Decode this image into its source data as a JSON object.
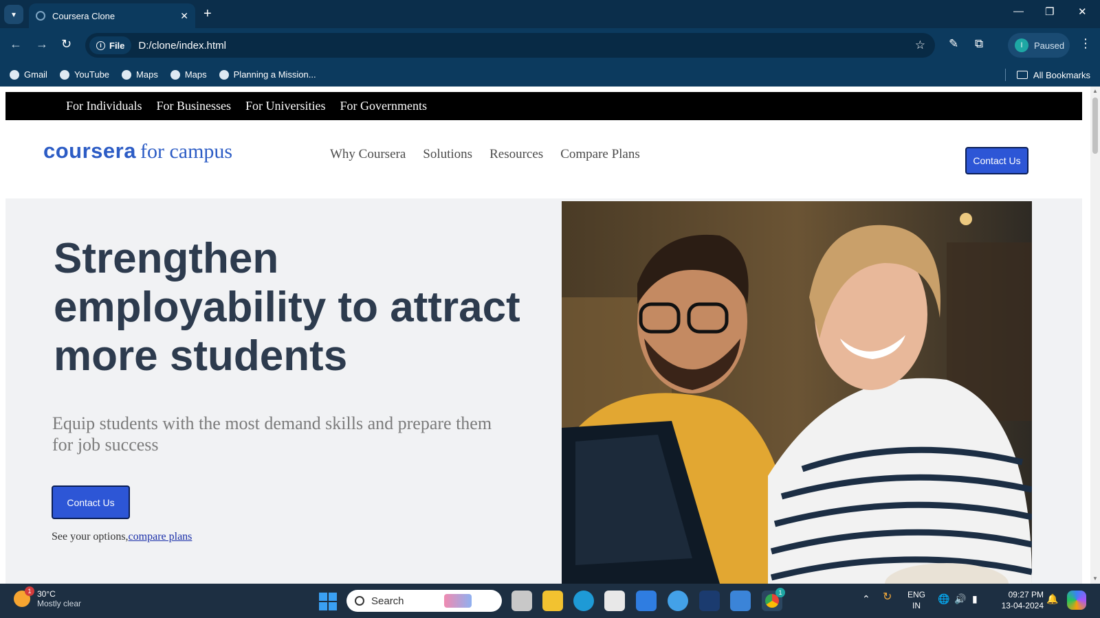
{
  "browser": {
    "tab_title": "Coursera Clone",
    "new_tab": "+",
    "url_chip": "File",
    "url": "D:/clone/index.html",
    "profile_initial": "I",
    "profile_status": "Paused",
    "bookmarks": [
      "Gmail",
      "YouTube",
      "Maps",
      "Maps",
      "Planning a Mission..."
    ],
    "all_bookmarks": "All Bookmarks"
  },
  "page": {
    "topbar": [
      "For Individuals",
      "For Businesses",
      "For Universities",
      "For Governments"
    ],
    "logo_brand": "coursera",
    "logo_suffix": "for campus",
    "nav": [
      "Why Coursera",
      "Solutions",
      "Resources",
      "Compare Plans"
    ],
    "header_cta": "Contact Us",
    "hero": {
      "title": "Strengthen employability to attract more students",
      "subtitle": "Equip students with the most demand skills and prepare them for job success",
      "cta": "Contact Us",
      "options_prefix": "See your options,",
      "options_link": "compare plans"
    }
  },
  "taskbar": {
    "temperature": "30°C",
    "weather": "Mostly clear",
    "weather_badge": "1",
    "search_placeholder": "Search",
    "chrome_badge": "1",
    "lang": "ENG",
    "region": "IN",
    "time": "09:27 PM",
    "date": "13-04-2024"
  },
  "colors": {
    "brand_blue": "#2c5cc5",
    "button_blue": "#2d56d6",
    "hero_text": "#2d3b4e",
    "chrome_bg": "#0c3a5e"
  }
}
